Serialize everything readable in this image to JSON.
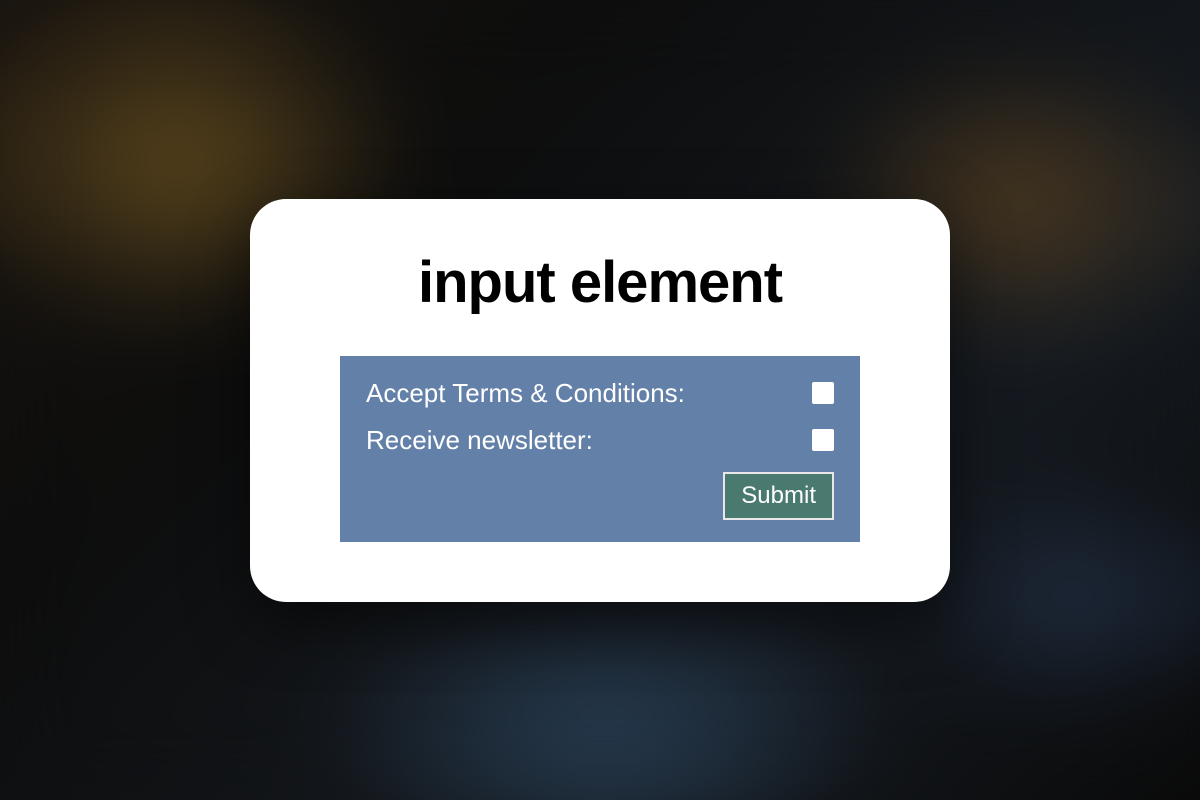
{
  "title": "input element",
  "form": {
    "terms_label": "Accept Terms & Conditions:",
    "newsletter_label": "Receive newsletter:",
    "submit_label": "Submit",
    "terms_checked": false,
    "newsletter_checked": false
  },
  "colors": {
    "panel_bg": "#6380a8",
    "button_bg": "#4a7a6f",
    "text_light": "#ffffff"
  }
}
